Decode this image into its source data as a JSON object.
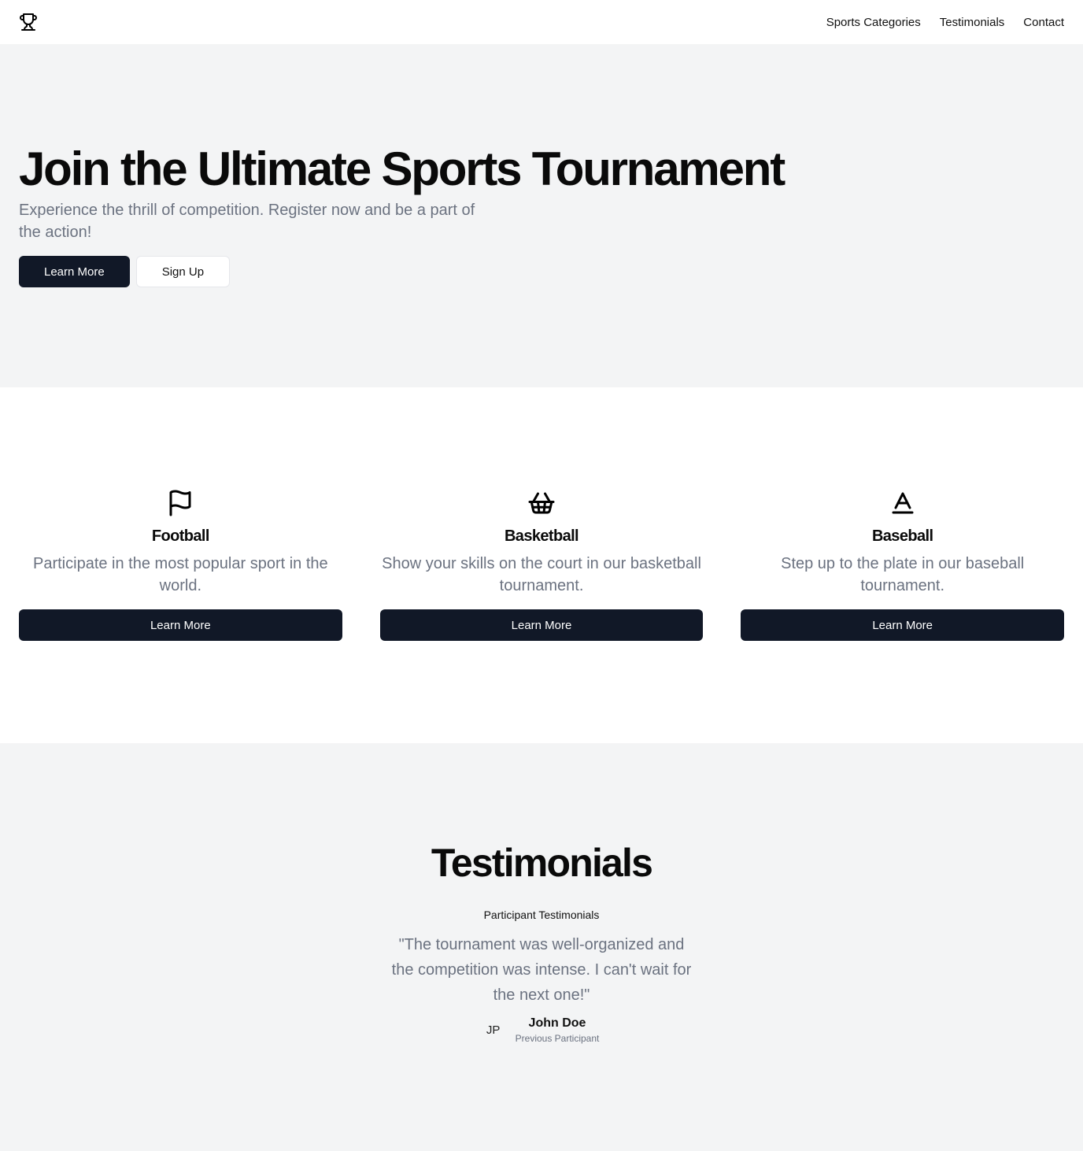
{
  "header": {
    "logo_icon": "trophy-icon",
    "nav": [
      {
        "label": "Sports Categories"
      },
      {
        "label": "Testimonials"
      },
      {
        "label": "Contact"
      }
    ]
  },
  "hero": {
    "title": "Join the Ultimate Sports Tournament",
    "subtitle": "Experience the thrill of competition. Register now and be a part of the action!",
    "primary_button": "Learn More",
    "secondary_button": "Sign Up"
  },
  "sports": [
    {
      "icon": "flag-icon",
      "title": "Football",
      "description": "Participate in the most popular sport in the world.",
      "button": "Learn More"
    },
    {
      "icon": "basket-icon",
      "title": "Basketball",
      "description": "Show your skills on the court in our basketball tournament.",
      "button": "Learn More"
    },
    {
      "icon": "baseline-a-icon",
      "title": "Baseball",
      "description": "Step up to the plate in our baseball tournament.",
      "button": "Learn More"
    }
  ],
  "testimonials": {
    "title": "Testimonials",
    "subtitle": "Participant Testimonials",
    "quote": "\"The tournament was well-organized and the competition was intense. I can't wait for the next one!\"",
    "avatar_initials": "JP",
    "author_name": "John Doe",
    "author_role": "Previous Participant"
  },
  "colors": {
    "primary_button": "#111827",
    "muted_text": "#6b7280",
    "section_bg": "#f3f4f5"
  }
}
